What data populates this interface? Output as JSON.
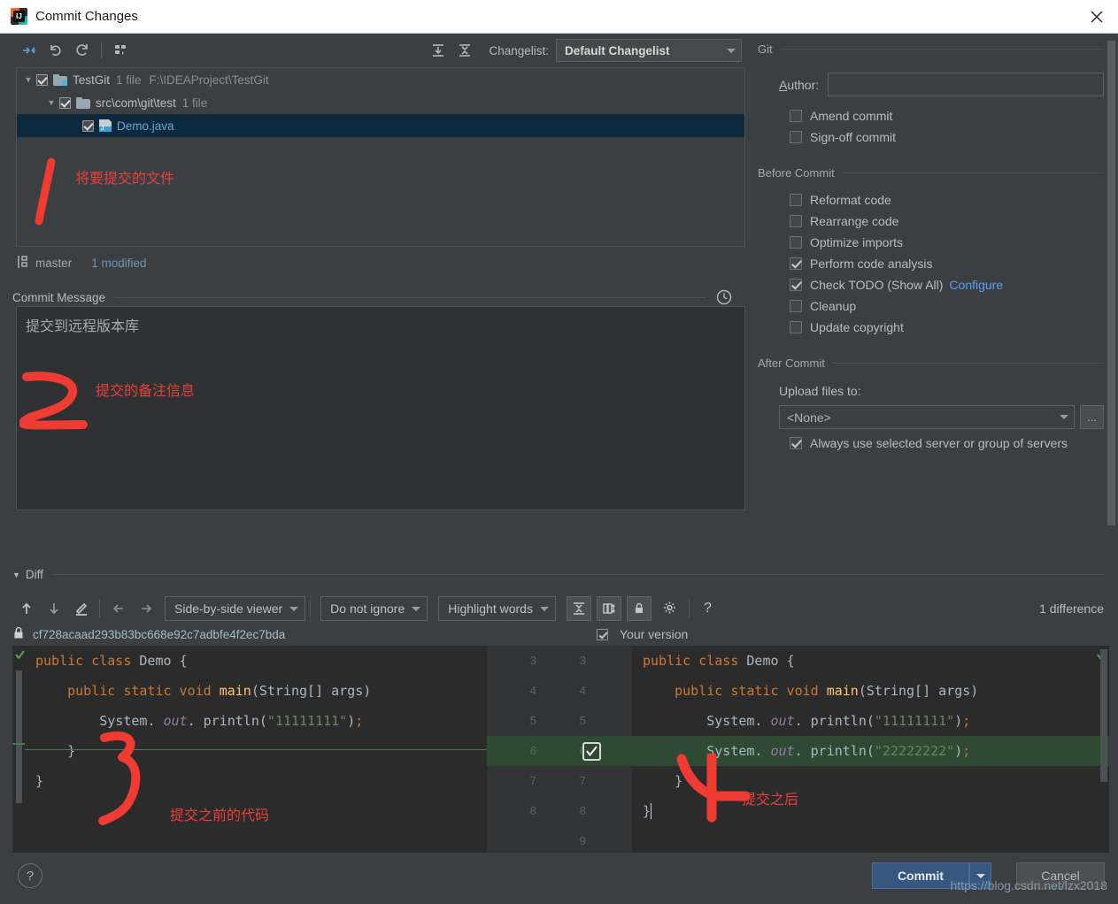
{
  "window": {
    "title": "Commit Changes",
    "close_icon": "close-icon",
    "app_icon": "intellij-logo"
  },
  "toolbar": {
    "buttons": [
      {
        "name": "show-diff-icon",
        "label": ""
      },
      {
        "name": "revert-icon",
        "label": ""
      },
      {
        "name": "refresh-icon",
        "label": ""
      },
      {
        "name": "group-by-icon",
        "label": ""
      },
      {
        "name": "expand-all-icon",
        "label": ""
      },
      {
        "name": "collapse-all-icon",
        "label": ""
      }
    ],
    "changelist_label": "Changelist:",
    "changelist_value": "Default Changelist"
  },
  "file_tree": [
    {
      "name": "TestGit",
      "meta": "1 file",
      "path": "F:\\IDEAProject\\TestGit",
      "checked": true,
      "expanded": true,
      "kind": "project",
      "selected": false,
      "indent": 0
    },
    {
      "name": "src\\com\\git\\test",
      "meta": "1 file",
      "path": "",
      "checked": true,
      "expanded": true,
      "kind": "folder",
      "selected": false,
      "indent": 1
    },
    {
      "name": "Demo.java",
      "meta": "",
      "path": "",
      "checked": true,
      "expanded": false,
      "kind": "java",
      "selected": true,
      "indent": 2
    }
  ],
  "branch_bar": {
    "icon": "branch-icon",
    "branch": "master",
    "modified": "1 modified"
  },
  "commit_message": {
    "title": "Commit Message",
    "history_icon": "history-clock-icon",
    "value": "提交到远程版本库"
  },
  "git_group": {
    "title": "Git",
    "author_label": "Author:",
    "author_value": "",
    "options": [
      {
        "label": "Amend commit",
        "checked": false
      },
      {
        "label": "Sign-off commit",
        "checked": false
      }
    ]
  },
  "before_commit_group": {
    "title": "Before Commit",
    "options": [
      {
        "label": "Reformat code",
        "checked": false
      },
      {
        "label": "Rearrange code",
        "checked": false
      },
      {
        "label": "Optimize imports",
        "checked": false
      },
      {
        "label": "Perform code analysis",
        "checked": true
      },
      {
        "label": "Check TODO (Show All)",
        "checked": true,
        "link": "Configure"
      },
      {
        "label": "Cleanup",
        "checked": false
      },
      {
        "label": "Update copyright",
        "checked": false
      }
    ]
  },
  "after_commit_group": {
    "title": "After Commit",
    "upload_label": "Upload files to:",
    "upload_value": "<None>",
    "browse_label": "...",
    "always_option": {
      "label": "Always use selected server or group of servers",
      "checked": true
    }
  },
  "diff": {
    "section_title": "Diff",
    "buttons": [
      {
        "name": "previous-difference-icon"
      },
      {
        "name": "next-difference-icon"
      },
      {
        "name": "edit-source-icon"
      },
      {
        "name": "apply-left-icon"
      },
      {
        "name": "apply-right-icon"
      }
    ],
    "viewer_mode": "Side-by-side viewer",
    "ignore_mode": "Do not ignore",
    "highlight_mode": "Highlight words",
    "toggle_icons": [
      {
        "name": "collapse-unchanged-icon"
      },
      {
        "name": "synchronize-scrolling-icon"
      },
      {
        "name": "read-only-lock-icon"
      },
      {
        "name": "diff-settings-gear-icon"
      },
      {
        "name": "help-question-icon"
      }
    ],
    "difference_count": "1 difference",
    "revision_lock_icon": "lock-icon",
    "revision_hash": "cf728acaad293b83bc668e92c7adbfe4f2ec7bda",
    "your_version_label": "Your version",
    "your_version_checked": true,
    "left_lines": [
      "public class Demo {",
      "    public static void main(String[] args)",
      "        System. out. println(\"11111111\");",
      "    }",
      "}"
    ],
    "right_lines": [
      "public class Demo {",
      "    public static void main(String[] args)",
      "        System. out. println(\"11111111\");",
      "        System. out. println(\"22222222\");",
      "    }",
      "}"
    ],
    "line_numbers_old": [
      "3",
      "4",
      "5",
      "6",
      "7",
      "8",
      ""
    ],
    "line_numbers_new": [
      "3",
      "4",
      "5",
      "6",
      "7",
      "8",
      "9"
    ],
    "added_line_index": 3,
    "added_line_checked": true
  },
  "footer": {
    "help_label": "?",
    "commit_label": "Commit",
    "commit_dropdown_icon": "chevron-down-icon",
    "cancel_label": "Cancel"
  },
  "watermark": "https://blog.csdn.net/lzx2018",
  "annotations": [
    {
      "id": "1",
      "text": "将要提交的文件"
    },
    {
      "id": "2",
      "text": "提交的备注信息"
    },
    {
      "id": "3",
      "text": "提交之前的代码"
    },
    {
      "id": "4",
      "text": "提交之后"
    }
  ],
  "colors": {
    "accent_blue": "#589df6",
    "annotation_red": "#e8403a",
    "added_green": "#2f4a32",
    "selection_blue": "#0d293e"
  }
}
